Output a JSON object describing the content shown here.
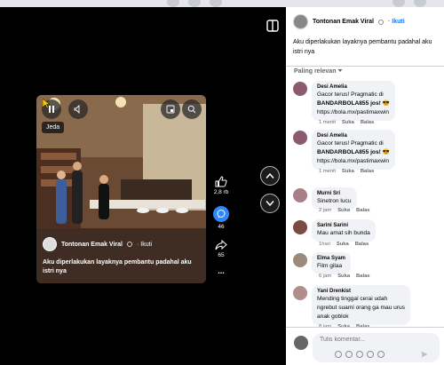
{
  "colors": {
    "accent": "#1877f2",
    "bubble": "#f0f2f5",
    "meta": "#65676b"
  },
  "video": {
    "pause_tooltip": "Jeda",
    "author": "Tontonan Emak Viral",
    "follow": "· Ikuti",
    "caption": "Aku diperlakukan layaknya pembantu padahal aku istri nya",
    "likes": "2,8 rb",
    "comments": "46",
    "shares": "65",
    "more": "..."
  },
  "post": {
    "author": "Tontonan Emak Viral",
    "follow": "· Ikuti",
    "text": "Aku diperlakukan layaknya pembantu padahal aku istri nya",
    "sort_label": "Paling relevan"
  },
  "comments": [
    {
      "name": "Desi Amelia",
      "lines": [
        "Gacor terus! Pragmatic di",
        "BANDARBOLA855 jos! 😎",
        "https://bola.mx/pastimaxwin"
      ],
      "time": "1 menit",
      "like": "Suka",
      "reply": "Balas"
    },
    {
      "name": "Desi Amelia",
      "lines": [
        "Gacor terus! Pragmatic di",
        "BANDARBOLA855 jos! 😎",
        "https://bola.mx/pastimaxwin"
      ],
      "time": "1 menit",
      "like": "Suka",
      "reply": "Balas"
    },
    {
      "name": "Murni Sri",
      "lines": [
        "Sinetron lucu"
      ],
      "time": "2 jam",
      "like": "Suka",
      "reply": "Balas"
    },
    {
      "name": "Sarini Sarini",
      "lines": [
        "Mau amat sih bunda"
      ],
      "time": "1hari",
      "like": "Suka",
      "reply": "Balas"
    },
    {
      "name": "Elma Syam",
      "lines": [
        "Film gilaa"
      ],
      "time": "6 jam",
      "like": "Suka",
      "reply": "Balas"
    },
    {
      "name": "Yani Drenkist",
      "lines": [
        "Mending tinggal cerai udah",
        "ngrebut suami orang ga mau urus",
        "anak goblok"
      ],
      "time": "8 jam",
      "like": "Suka",
      "reply": "Balas"
    }
  ],
  "composer": {
    "placeholder": "Tulis komentar..."
  }
}
